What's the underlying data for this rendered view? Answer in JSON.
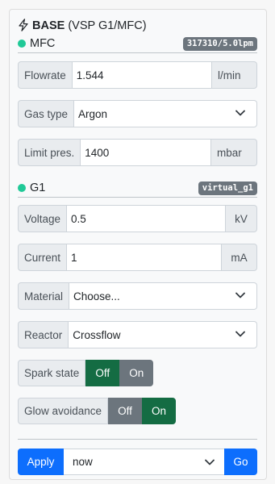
{
  "header": {
    "title_bold": "BASE",
    "title_rest": "(VSP G1/MFC)"
  },
  "mfc": {
    "label": "MFC",
    "badge": "317310/5.0lpm",
    "status_color": "#20c997",
    "flowrate": {
      "label": "Flowrate",
      "value": "1.544",
      "unit": "l/min"
    },
    "gas_type": {
      "label": "Gas type",
      "value": "Argon"
    },
    "limit_pres": {
      "label": "Limit pres.",
      "value": "1400",
      "unit": "mbar"
    }
  },
  "g1": {
    "label": "G1",
    "badge": "virtual_g1",
    "status_color": "#20c997",
    "voltage": {
      "label": "Voltage",
      "value": "0.5",
      "unit": "kV"
    },
    "current": {
      "label": "Current",
      "value": "1",
      "unit": "mA"
    },
    "material": {
      "label": "Material",
      "value": "Choose..."
    },
    "reactor": {
      "label": "Reactor",
      "value": "Crossflow"
    },
    "spark_state": {
      "label": "Spark state",
      "off": "Off",
      "on": "On",
      "active": "Off"
    },
    "glow_avoidance": {
      "label": "Glow avoidance",
      "off": "Off",
      "on": "On",
      "active": "On"
    }
  },
  "footer": {
    "apply_label": "Apply",
    "when_value": "now",
    "go_label": "Go"
  },
  "colors": {
    "primary": "#0d6efd",
    "toggle_active": "#146c43",
    "toggle_inactive": "#6c757d",
    "badge": "#6c757d"
  },
  "icons": {
    "title": "lightning-icon",
    "select": "chevron-down-icon"
  }
}
